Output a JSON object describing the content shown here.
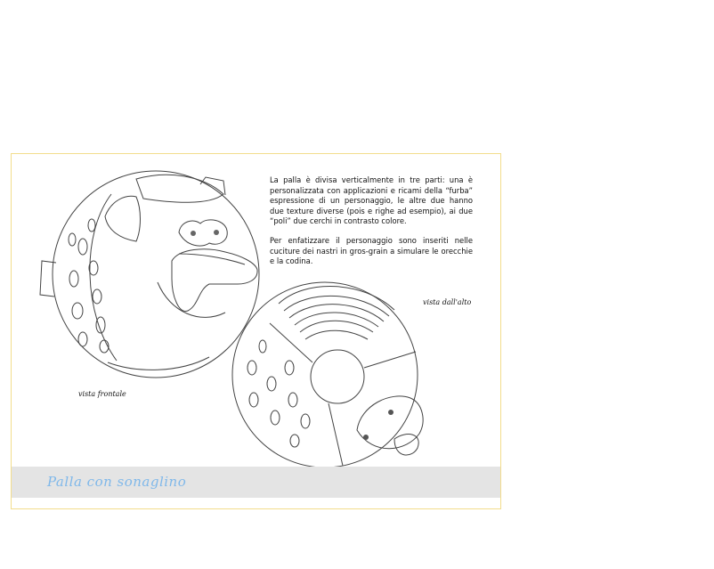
{
  "description": {
    "paragraph_1": "La palla è divisa verticalmente in tre parti: una è personalizzata con applicazioni e ricami della “furba” espressione di un personaggio, le altre due hanno due texture diverse (pois e righe ad esempio), ai due “poli” due cerchi in contrasto colore.",
    "paragraph_2": "Per enfatizzare il personaggio sono inseriti nelle cuciture dei nastri in gros-grain a simulare le orecchie e la codina."
  },
  "captions": {
    "front_view": "vista frontale",
    "top_view": "vista dall'alto"
  },
  "title_band": {
    "title": "Palla con sonaglino",
    "title_color": "#7fb8ea",
    "band_color": "#e4e4e4"
  },
  "sheet_border_color": "#f3dd8c"
}
